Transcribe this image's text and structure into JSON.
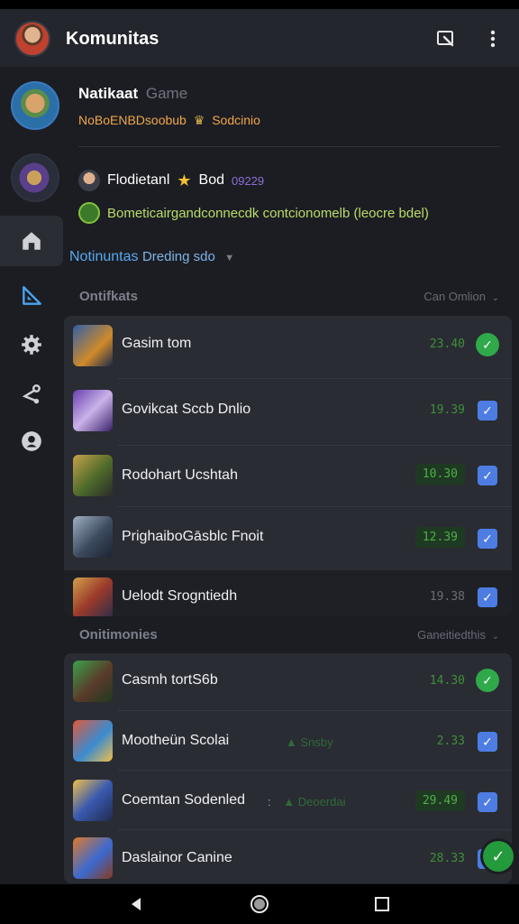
{
  "status_bar": {
    "left_text": "",
    "right_text": ""
  },
  "app_bar": {
    "title": "Komunitas",
    "icons": [
      "avatar",
      "edit-icon",
      "more-vert-icon"
    ]
  },
  "posts": [
    {
      "name": "Natikaat",
      "tag": "Game",
      "subtitle": "NoBoENBDsoobub",
      "subtitle_badge": "Sodcinio"
    },
    {
      "author": "Flodietanl",
      "author2": "Bod",
      "count": "09229",
      "description": "Bometicairgandconnecdk contcionomelb (leocre bdel)"
    }
  ],
  "communities_heading": {
    "title": "Notinuntas",
    "subtitle": "Dreding sdo"
  },
  "sidebar": {
    "items": [
      {
        "icon": "home-icon",
        "active": true
      },
      {
        "icon": "ruler-icon",
        "active": false
      },
      {
        "icon": "gear-icon",
        "active": false
      },
      {
        "icon": "share-icon",
        "active": false
      },
      {
        "icon": "profile-icon",
        "active": false
      }
    ]
  },
  "section1": {
    "label": "Ontifkats",
    "right": "Can Omlion"
  },
  "section1_rows": [
    {
      "label": "Gasim tom",
      "time": "23.40",
      "check": "round",
      "boxed": false
    },
    {
      "label": "Govikcat Sccb Dnlio",
      "time": "19.39",
      "check": "square",
      "boxed": false
    },
    {
      "label": "Rodohart Ucshtah",
      "time": "10.30",
      "check": "square",
      "boxed": true
    },
    {
      "label": "PrighaiboGāsblc Fnoit",
      "time": "12.39",
      "check": "square",
      "boxed": true
    },
    {
      "label": "Uelodt Srogntiedh",
      "time": "19.38",
      "check": "square",
      "boxed": false
    }
  ],
  "section2": {
    "label": "Onitimonies",
    "right": "Ganeitiedthis"
  },
  "section2_rows": [
    {
      "label": "Casmh tortS6b",
      "time": "14.30",
      "check": "round",
      "boxed": false,
      "extra": ""
    },
    {
      "label": "Mootheün Scolai",
      "time": "2.33",
      "check": "square",
      "boxed": false,
      "extra": "Snsby"
    },
    {
      "label": "Coemtan Sodenled",
      "time": "29.49",
      "check": "square",
      "boxed": true,
      "extra": "Deoerdai"
    },
    {
      "label": "Daslainor Canine",
      "time": "28.33",
      "check": "square",
      "boxed": false,
      "extra": ""
    }
  ],
  "colors": {
    "background": "#1c1d22",
    "card": "#2a2c33",
    "accent_blue": "#56a9f0",
    "check_blue": "#4d7de3",
    "green": "#2fa94a",
    "orange": "#f0a64b",
    "lime": "#b9dc6a"
  },
  "nav_bar": {
    "buttons": [
      "back-icon",
      "home-circle-icon",
      "recents-icon"
    ]
  }
}
